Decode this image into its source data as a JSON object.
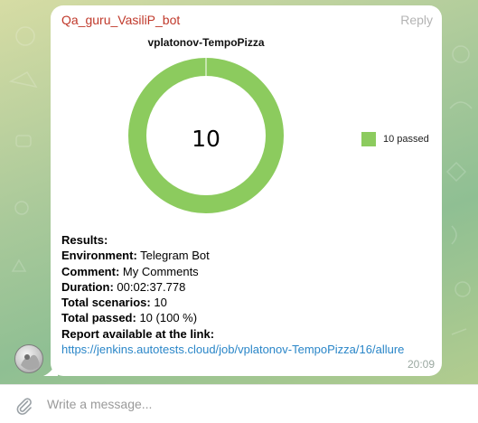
{
  "chat": {
    "message": {
      "sender": "Qa_guru_VasiliP_bot",
      "reply_label": "Reply",
      "time": "20:09",
      "results_heading": "Results:",
      "fields": [
        {
          "label": "Environment:",
          "value": " Telegram Bot"
        },
        {
          "label": "Comment:",
          "value": " My Comments"
        },
        {
          "label": "Duration:",
          "value": " 00:02:37.778"
        },
        {
          "label": "Total scenarios:",
          "value": " 10"
        },
        {
          "label": "Total passed:",
          "value": " 10 (100 %)"
        }
      ],
      "report_label": "Report available at the link:",
      "report_link": "https://jenkins.autotests.cloud/job/vplatonov-TempoPizza/16/allure"
    }
  },
  "chart_data": {
    "type": "pie",
    "title": "vplatonov-TempoPizza",
    "center_label": "10",
    "slices": [
      {
        "name": "10 passed",
        "value": 10,
        "color": "#8ccb5e"
      }
    ],
    "legend_position": "right"
  },
  "composer": {
    "placeholder": "Write a message...",
    "attach_icon": "paperclip-icon"
  }
}
